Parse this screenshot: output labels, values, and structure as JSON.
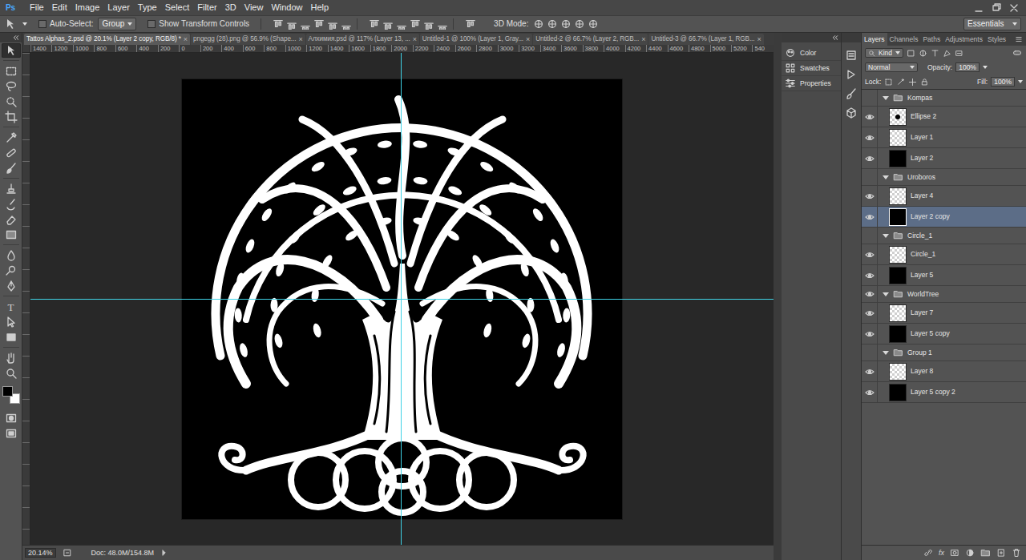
{
  "app": {
    "logo": "Ps"
  },
  "menu": [
    "File",
    "Edit",
    "Image",
    "Layer",
    "Type",
    "Select",
    "Filter",
    "3D",
    "View",
    "Window",
    "Help"
  ],
  "options_bar": {
    "auto_select": {
      "label": "Auto-Select:",
      "checked": false
    },
    "auto_select_target": "Group",
    "show_transform": {
      "label": "Show Transform Controls",
      "checked": false
    },
    "mode_label": "3D Mode:",
    "workspace": "Essentials"
  },
  "tabs": [
    {
      "label": "Tattos Alphas_2.psd @ 20.1% (Layer 2 copy, RGB/8) *",
      "close": "×",
      "selected": true
    },
    {
      "label": "pngegg (28).png @ 56.9% (Shape...",
      "close": "×",
      "selected": false
    },
    {
      "label": "Алхимия.psd @ 117% (Layer 13, ...",
      "close": "×",
      "selected": false
    },
    {
      "label": "Untitled-1 @ 100% (Layer 1, Gray...",
      "close": "×",
      "selected": false
    },
    {
      "label": "Untitled-2 @ 66.7% (Layer 2, RGB...",
      "close": "×",
      "selected": false
    },
    {
      "label": "Untitled-3 @ 66.7% (Layer 1, RGB...",
      "close": "×",
      "selected": false
    }
  ],
  "ruler": {
    "marks": [
      "1400",
      "1200",
      "1000",
      "800",
      "600",
      "400",
      "200",
      "0",
      "200",
      "400",
      "600",
      "800",
      "1000",
      "1200",
      "1400",
      "1600",
      "1800",
      "2000",
      "2200",
      "2400",
      "2600",
      "2800",
      "3000",
      "3200",
      "3400",
      "3600",
      "3800",
      "4000",
      "4200",
      "4400",
      "4600",
      "4800",
      "5000",
      "5200",
      "540"
    ]
  },
  "tools": [
    {
      "kind": "move",
      "selected": true
    },
    {
      "kind": "marquee",
      "selected": false
    },
    {
      "kind": "lasso",
      "selected": false
    },
    {
      "kind": "quick-select",
      "selected": false
    },
    {
      "kind": "crop",
      "selected": false
    },
    {
      "kind": "eyedropper",
      "selected": false
    },
    {
      "kind": "healing",
      "selected": false
    },
    {
      "kind": "brush",
      "selected": false
    },
    {
      "kind": "stamp",
      "selected": false
    },
    {
      "kind": "history",
      "selected": false
    },
    {
      "kind": "eraser",
      "selected": false
    },
    {
      "kind": "gradient",
      "selected": false
    },
    {
      "kind": "blur",
      "selected": false
    },
    {
      "kind": "dodge",
      "selected": false
    },
    {
      "kind": "pen",
      "selected": false
    },
    {
      "kind": "type",
      "glyph": "T",
      "selected": false
    },
    {
      "kind": "path-select",
      "selected": false
    },
    {
      "kind": "shape",
      "selected": false
    },
    {
      "kind": "hand",
      "selected": false
    },
    {
      "kind": "zoom",
      "selected": false
    }
  ],
  "colors": {
    "foreground": "#000000",
    "background": "#ffffff"
  },
  "status_bar": {
    "zoom": "20.14%",
    "doc": "Doc: 48.0M/154.8M"
  },
  "dock_panels": [
    "Color",
    "Swatches",
    "Properties"
  ],
  "layers_panel": {
    "tabs": [
      {
        "label": "Layers",
        "selected": true
      },
      {
        "label": "Channels",
        "selected": false
      },
      {
        "label": "Paths",
        "selected": false
      },
      {
        "label": "Adjustments",
        "selected": false
      },
      {
        "label": "Styles",
        "selected": false
      }
    ],
    "filter": "Kind",
    "blend_mode": "Normal",
    "opacity_label": "Opacity:",
    "opacity": "100%",
    "lock_label": "Lock:",
    "fill_label": "Fill:",
    "fill": "100%",
    "layers": [
      {
        "name": "Kompas",
        "kind": "group",
        "visible": false,
        "expanded": true,
        "selected": false
      },
      {
        "name": "Ellipse 2",
        "kind": "layer",
        "thumb": "dot",
        "visible": true,
        "selected": false
      },
      {
        "name": "Layer 1",
        "kind": "layer",
        "thumb": "transparent",
        "visible": true,
        "selected": false
      },
      {
        "name": "Layer 2",
        "kind": "layer",
        "thumb": "black",
        "visible": true,
        "selected": false
      },
      {
        "name": "Uroboros",
        "kind": "group",
        "visible": false,
        "expanded": true,
        "selected": false
      },
      {
        "name": "Layer 4",
        "kind": "layer",
        "thumb": "transparent",
        "visible": true,
        "selected": false
      },
      {
        "name": "Layer 2 copy",
        "kind": "layer",
        "thumb": "black",
        "visible": true,
        "selected": true
      },
      {
        "name": "Circle_1",
        "kind": "group",
        "visible": false,
        "expanded": true,
        "selected": false
      },
      {
        "name": "Circle_1",
        "kind": "layer",
        "thumb": "transparent",
        "visible": true,
        "selected": false
      },
      {
        "name": "Layer 5",
        "kind": "layer",
        "thumb": "black",
        "visible": true,
        "selected": false
      },
      {
        "name": "WorldTree",
        "kind": "group",
        "visible": true,
        "expanded": true,
        "selected": false
      },
      {
        "name": "Layer 7",
        "kind": "layer",
        "thumb": "transparent",
        "visible": true,
        "selected": false
      },
      {
        "name": "Layer 5 copy",
        "kind": "layer",
        "thumb": "black",
        "visible": true,
        "selected": false
      },
      {
        "name": "Group 1",
        "kind": "group",
        "visible": false,
        "expanded": true,
        "selected": false
      },
      {
        "name": "Layer 8",
        "kind": "layer",
        "thumb": "transparent",
        "visible": true,
        "selected": false
      },
      {
        "name": "Layer 5 copy 2",
        "kind": "layer",
        "thumb": "black",
        "visible": true,
        "selected": false
      }
    ],
    "footer_fx": "fx"
  }
}
